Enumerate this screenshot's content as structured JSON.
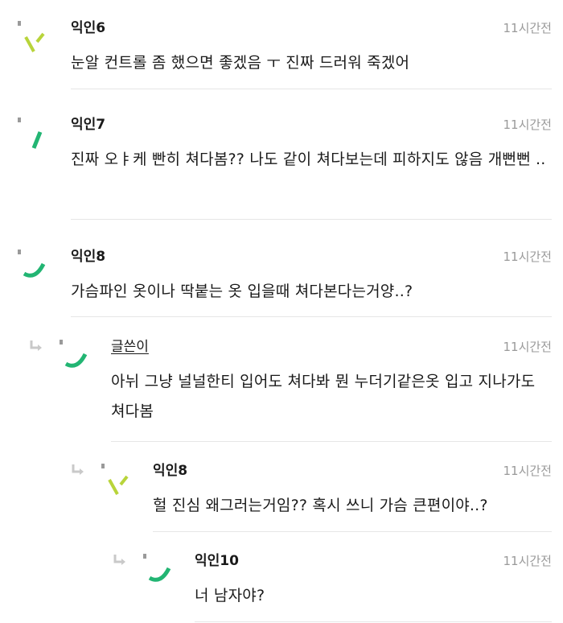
{
  "comments": [
    {
      "author": "익인6",
      "time": "11시간전",
      "text": "눈알 컨트롤 좀 했으면 좋겠음 ㅜ 진짜 드러워 죽겠어",
      "avatar_icon": "anon-avatar-slashes-icon"
    },
    {
      "author": "익인7",
      "time": "11시간전",
      "text": "진짜 오ㅑ케 빤히 쳐다봄?? 나도 같이 쳐다보는데 피하지도 않음 개뻔뻔 ..",
      "avatar_icon": "anon-avatar-slash-icon"
    },
    {
      "author": "익인8",
      "time": "11시간전",
      "text": "가슴파인 옷이나 딱붙는 옷 입을때 쳐다본다는거양..?",
      "avatar_icon": "anon-avatar-arc-icon"
    },
    {
      "author": "글쓴이",
      "time": "11시간전",
      "text": "아뉘 그냥 널널한티 입어도 쳐다봐 뭔 누더기같은옷 입고 지나가도 쳐다봄",
      "avatar_icon": "anon-avatar-arc-icon"
    },
    {
      "author": "익인8",
      "time": "11시간전",
      "text": "헐 진심 왜그러는거임?? 혹시 쓰니 가슴 큰편이야..?",
      "avatar_icon": "anon-avatar-slashes-icon"
    },
    {
      "author": "익인10",
      "time": "11시간전",
      "text": "너 남자야?",
      "avatar_icon": "anon-avatar-arc-icon"
    }
  ],
  "colors": {
    "green": "#22b573",
    "lime": "#b8d43a",
    "text": "#1a1a1a",
    "meta": "#9a9a9a",
    "divider": "#e6e6e6"
  }
}
